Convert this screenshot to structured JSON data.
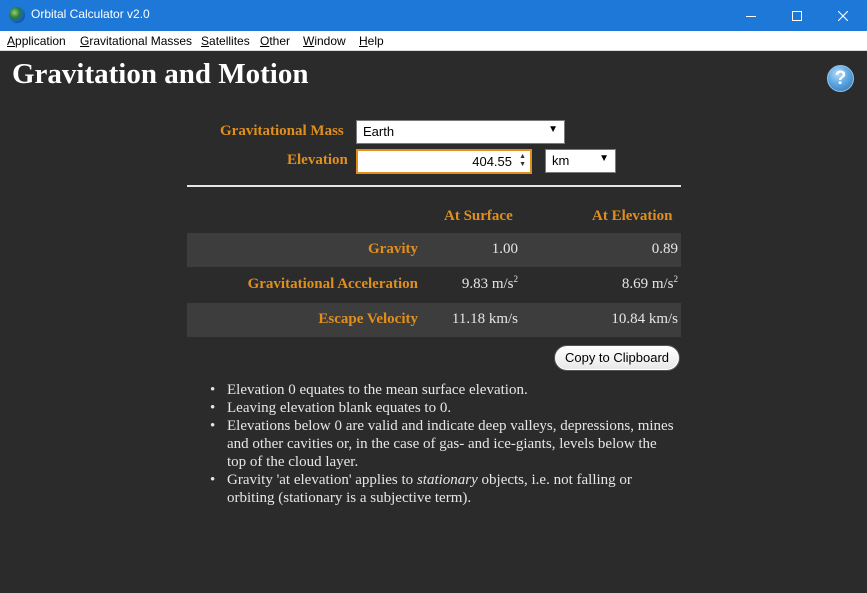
{
  "window": {
    "title": "Orbital Calculator v2.0",
    "minimize_glyph": "—",
    "colors": {
      "titlebar": "#1e78d7",
      "content_bg": "#2b2b2b",
      "accent": "#e08f1c"
    }
  },
  "menu": [
    {
      "key": "A",
      "rest": "pplication"
    },
    {
      "key": "G",
      "rest": "ravitational Masses"
    },
    {
      "key": "S",
      "rest": "atellites"
    },
    {
      "key": "O",
      "rest": "ther"
    },
    {
      "key": "W",
      "rest": "indow"
    },
    {
      "key": "H",
      "rest": "elp"
    }
  ],
  "page": {
    "title": "Gravitation and Motion",
    "help_glyph": "?"
  },
  "form": {
    "mass_label": "Gravitational Mass",
    "mass_value": "Earth",
    "elevation_label": "Elevation",
    "elevation_value": "404.55",
    "unit_value": "km"
  },
  "results": {
    "col_surface": "At Surface",
    "col_elevation": "At Elevation",
    "rows": [
      {
        "label": "Gravity",
        "surface": "1.00",
        "elevation": "0.89"
      },
      {
        "label": "Gravitational Acceleration",
        "surface": "9.83 m/s",
        "surface_exp": "2",
        "elevation": "8.69 m/s",
        "elevation_exp": "2"
      },
      {
        "label": "Escape Velocity",
        "surface": "11.18 km/s",
        "elevation": "10.84 km/s"
      }
    ]
  },
  "copy_button": "Copy to Clipboard",
  "notes": {
    "n1": "Elevation 0 equates to the mean surface elevation.",
    "n2": "Leaving elevation blank equates to 0.",
    "n3": "Elevations below 0 are valid and indicate deep valleys, depressions, mines and other cavities or, in the case of gas- and ice-giants, levels below the top of the cloud layer.",
    "n4_pre": "Gravity 'at elevation' applies to ",
    "n4_em": "stationary",
    "n4_post": " objects, i.e. not falling or orbiting (stationary is a subjective term)."
  }
}
